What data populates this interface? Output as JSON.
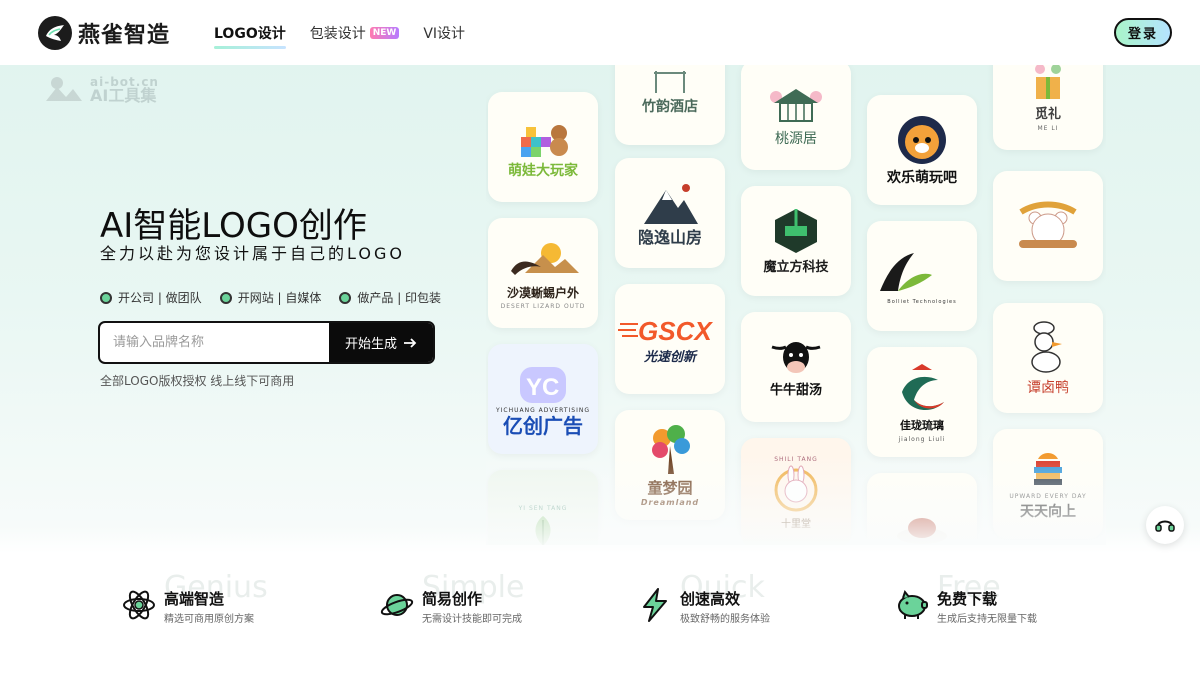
{
  "brand": {
    "name": "燕雀智造"
  },
  "nav": [
    {
      "label": "LOGO设计",
      "active": true
    },
    {
      "label": "包装设计",
      "badge": "NEW"
    },
    {
      "label": "VI设计"
    }
  ],
  "login_label": "登录",
  "watermark": {
    "line1": "ai-bot.cn",
    "line2": "AI工具集"
  },
  "hero": {
    "title": "AI智能LOGO创作",
    "subtitle": "全力以赴为您设计属于自己的LOGO",
    "features": [
      "开公司 | 做团队",
      "开网站 | 自媒体",
      "做产品 | 印包装"
    ],
    "search_placeholder": "请输入品牌名称",
    "button_label": "开始生成",
    "note": "全部LOGO版权授权 线上线下可商用"
  },
  "gallery": [
    {
      "title": "萌娃大玩家",
      "sub": ""
    },
    {
      "title": "沙漠蜥蜴户外",
      "sub": "DESERT LIZARD OUTD"
    },
    {
      "title": "亿创广告",
      "sub": "YICHUANG ADVERTISING"
    },
    {
      "title": "",
      "sub": "YI SEN TANG"
    },
    {
      "title": "竹韵酒店",
      "sub": ""
    },
    {
      "title": "隐逸山房",
      "sub": ""
    },
    {
      "title": "光速创新",
      "sub": ""
    },
    {
      "title": "童梦园",
      "sub": "Dreamland"
    },
    {
      "title": "桃源居",
      "sub": ""
    },
    {
      "title": "魔立方科技",
      "sub": ""
    },
    {
      "title": "牛牛甜汤",
      "sub": ""
    },
    {
      "title": "十里堂",
      "sub": "SHILI TANG"
    },
    {
      "title": "欢乐萌玩吧",
      "sub": ""
    },
    {
      "title": "",
      "sub": "Bolliet Technologies"
    },
    {
      "title": "佳珑琉璃",
      "sub": "jialong Liuli"
    },
    {
      "title": "觅礼",
      "sub": "ME LI"
    },
    {
      "title": "谭卤鸭",
      "sub": ""
    },
    {
      "title": "天天向上",
      "sub": "UPWARD EVERY DAY"
    }
  ],
  "bottom_features": [
    {
      "ghost": "Genius",
      "title": "高端智造",
      "desc": "精选可商用原创方案"
    },
    {
      "ghost": "Simple",
      "title": "简易创作",
      "desc": "无需设计技能即可完成"
    },
    {
      "ghost": "Quick",
      "title": "创速高效",
      "desc": "极致舒畅的服务体验"
    },
    {
      "ghost": "Free",
      "title": "免费下载",
      "desc": "生成后支持无限量下载"
    }
  ],
  "icons": {
    "logo": "bird-logo-icon",
    "arrow": "arrow-right-icon",
    "support": "headset-icon",
    "bottom": [
      "atom-icon",
      "planet-icon",
      "lightning-icon",
      "piggy-bank-icon"
    ]
  }
}
